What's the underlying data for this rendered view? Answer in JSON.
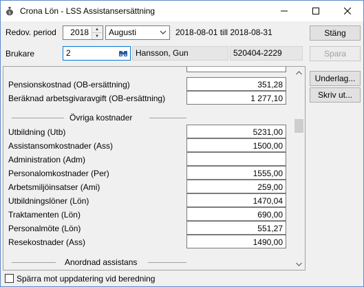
{
  "window": {
    "title": "Crona Lön - LSS Assistansersättning",
    "minimize": "—",
    "maximize": "☐",
    "close": "✕"
  },
  "period": {
    "label": "Redov. period",
    "year": "2018",
    "month": "Augusti",
    "range": "2018-08-01 till 2018-08-31"
  },
  "brukare": {
    "label": "Brukare",
    "id": "2",
    "name": "Hansson, Gun",
    "personnr": "520404-2229"
  },
  "buttons": {
    "stang": "Stäng",
    "spara": "Spara",
    "underlag": "Underlag...",
    "skriv_ut": "Skriv ut..."
  },
  "rows_top": [
    {
      "label": "Pensionskostnad (OB-ersättning)",
      "value": "351,28"
    },
    {
      "label": "Beräknad arbetsgivaravgift (OB-ersättning)",
      "value": "1 277,10"
    }
  ],
  "section_ovriga": "Övriga kostnader",
  "rows_ovriga": [
    {
      "label": "Utbildning (Utb)",
      "value": "5231,00"
    },
    {
      "label": "Assistansomkostnader (Ass)",
      "value": "1500,00"
    },
    {
      "label": "Administration (Adm)",
      "value": ""
    },
    {
      "label": "Personalomkostnader (Per)",
      "value": "1555,00"
    },
    {
      "label": "Arbetsmiljöinsatser (Ami)",
      "value": "259,00"
    },
    {
      "label": "Utbildningslöner (Lön)",
      "value": "1470,04"
    },
    {
      "label": "Traktamenten (Lön)",
      "value": "690,00"
    },
    {
      "label": "Personalmöte (Lön)",
      "value": "551,27"
    },
    {
      "label": "Resekostnader (Ass)",
      "value": "1490,00"
    }
  ],
  "section_anordnad": "Anordnad assistans",
  "checkbox_label": "Spärra mot uppdatering vid beredning"
}
